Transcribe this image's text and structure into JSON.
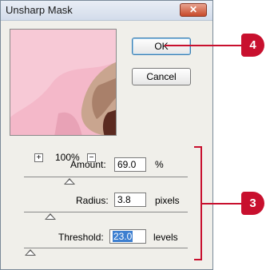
{
  "dialog": {
    "title": "Unsharp Mask",
    "close_glyph": "✕",
    "ok_label": "OK",
    "cancel_label": "Cancel",
    "zoom": {
      "value": "100%",
      "plus_glyph": "+",
      "minus_glyph": "−"
    },
    "amount": {
      "label": "Amount:",
      "value": "69.0",
      "unit": "%",
      "level": 0.28
    },
    "radius": {
      "label": "Radius:",
      "value": "3.8",
      "unit": "pixels",
      "level": 0.16
    },
    "threshold": {
      "label": "Threshold:",
      "value": "23.0",
      "unit": "levels",
      "level": 0.04
    }
  },
  "callouts": {
    "ok_step": "4",
    "settings_step": "3",
    "color": "#c8102e"
  }
}
